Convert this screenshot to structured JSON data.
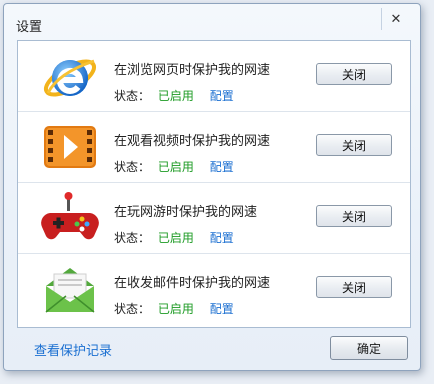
{
  "window": {
    "title": "设置",
    "close_symbol": "✕"
  },
  "rows": [
    {
      "icon": "internet-explorer-icon",
      "description": "在浏览网页时保护我的网速",
      "status_label": "状态：",
      "status_value": "已启用",
      "config_label": "配置",
      "button_label": "关闭"
    },
    {
      "icon": "video-player-icon",
      "description": "在观看视频时保护我的网速",
      "status_label": "状态：",
      "status_value": "已启用",
      "config_label": "配置",
      "button_label": "关闭"
    },
    {
      "icon": "gamepad-icon",
      "description": "在玩网游时保护我的网速",
      "status_label": "状态：",
      "status_value": "已启用",
      "config_label": "配置",
      "button_label": "关闭"
    },
    {
      "icon": "mail-envelope-icon",
      "description": "在收发邮件时保护我的网速",
      "status_label": "状态：",
      "status_value": "已启用",
      "config_label": "配置",
      "button_label": "关闭"
    }
  ],
  "footer": {
    "history_link": "查看保护记录",
    "ok_label": "确定"
  },
  "colors": {
    "enabled": "#1d9b24",
    "link": "#1b6fd1"
  }
}
